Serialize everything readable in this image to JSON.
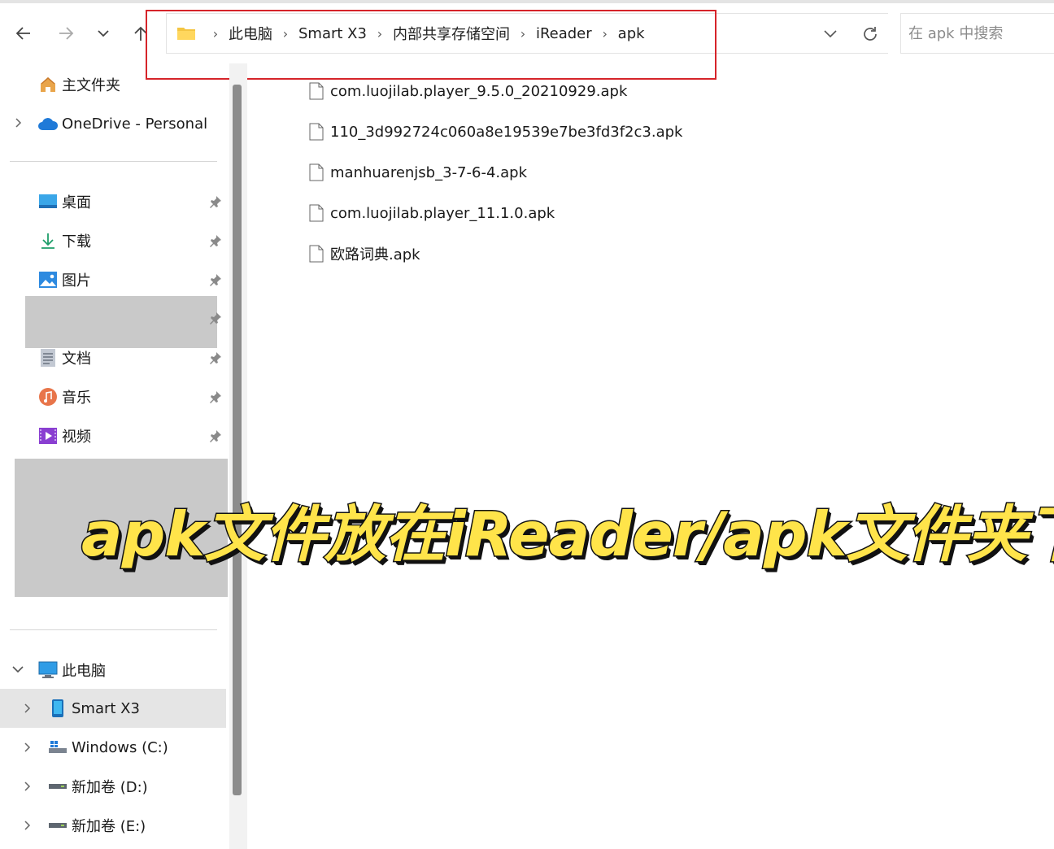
{
  "address": {
    "crumbs": [
      "此电脑",
      "Smart X3",
      "内部共享存储空间",
      "iReader",
      "apk"
    ],
    "separator": "›"
  },
  "search": {
    "placeholder": "在 apk 中搜索"
  },
  "sidebar": {
    "home": "主文件夹",
    "onedrive": "OneDrive - Personal",
    "quick": [
      {
        "label": "桌面",
        "icon": "desktop-icon"
      },
      {
        "label": "下载",
        "icon": "download-icon"
      },
      {
        "label": "图片",
        "icon": "pictures-icon"
      },
      {
        "label": "文档",
        "icon": "documents-icon"
      },
      {
        "label": "音乐",
        "icon": "music-icon"
      },
      {
        "label": "视频",
        "icon": "videos-icon"
      }
    ],
    "this_pc": "此电脑",
    "drives": [
      "Smart X3",
      "Windows (C:)",
      "新加卷 (D:)",
      "新加卷 (E:)"
    ]
  },
  "files": [
    "com.luojilab.player_9.5.0_20210929.apk",
    "110_3d992724c060a8e19539e7be3fd3f2c3.apk",
    "manhuarenjsb_3-7-6-4.apk",
    "com.luojilab.player_11.1.0.apk",
    "欧路词典.apk"
  ],
  "caption": "apk文件放在iReader/apk文件夹下",
  "colors": {
    "highlight": "#d6242a",
    "caption": "#ffe44a",
    "selected": "#e5e5e5"
  }
}
